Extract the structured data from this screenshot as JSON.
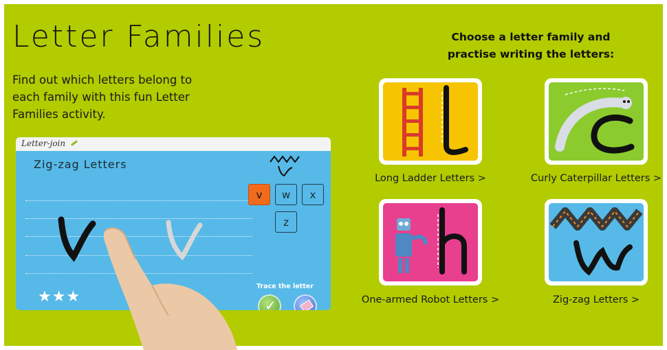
{
  "page": {
    "title": "Letter Families",
    "intro": "Find out which letters belong to each family with this fun Letter Families activity.",
    "background": "#b2cc00"
  },
  "demo": {
    "brand": "Letter-join",
    "heading": "Zig-zag Letters",
    "trace_label": "Trace the letter",
    "stars": "★★★",
    "keys": [
      "v",
      "w",
      "x",
      "z"
    ],
    "active_key": "v",
    "panel_color": "#57b9e8",
    "active_color": "#f26b1d"
  },
  "families": {
    "prompt_line1": "Choose a letter family and",
    "prompt_line2": "practise writing the letters:",
    "items": [
      {
        "label": "Long Ladder Letters >",
        "color": "#f6c400"
      },
      {
        "label": "Curly Caterpillar Letters >",
        "color": "#8ccb2e"
      },
      {
        "label": "One-armed Robot Letters >",
        "color": "#e83f8e"
      },
      {
        "label": "Zig-zag Letters >",
        "color": "#57b9e8"
      }
    ]
  }
}
